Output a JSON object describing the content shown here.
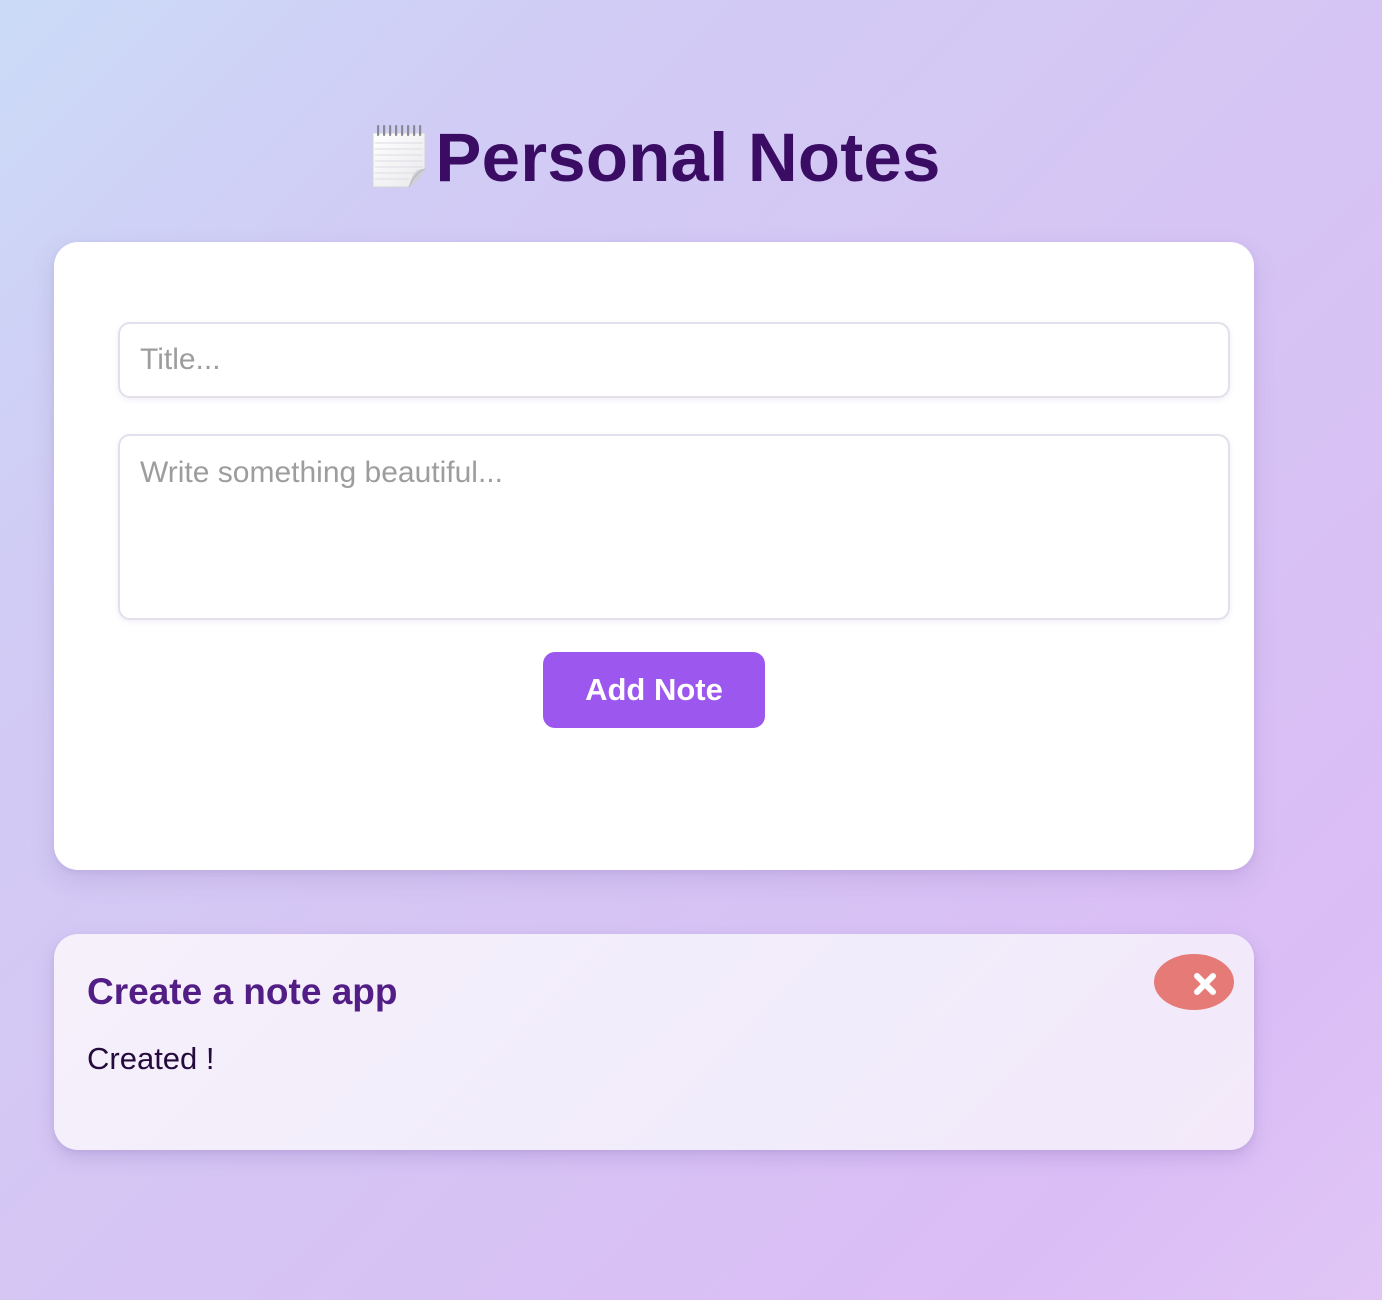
{
  "header": {
    "icon": "notepad-spiral-icon",
    "title": "Personal Notes"
  },
  "composer": {
    "title_placeholder": "Title...",
    "title_value": "",
    "content_placeholder": "Write something beautiful...",
    "content_value": "",
    "add_button_label": "Add Note"
  },
  "notes": [
    {
      "title": "Create a note app",
      "body": "Created !",
      "delete_icon": "close-x-icon"
    }
  ],
  "colors": {
    "title": "#3b0c63",
    "accent": "#9c57ee",
    "note_title": "#521e85",
    "delete": "#e67a77"
  }
}
